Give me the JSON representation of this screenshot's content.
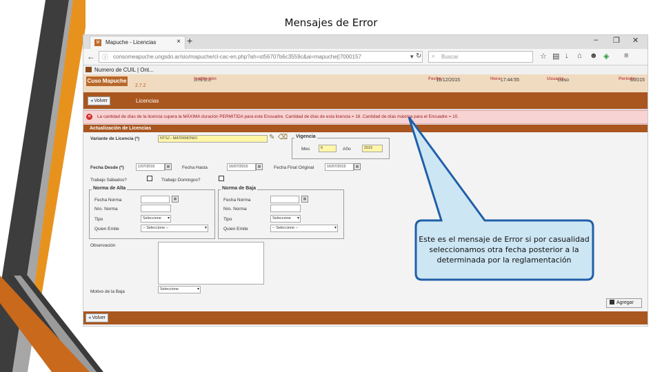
{
  "slide": {
    "title": "Mensajes de Error"
  },
  "browser": {
    "tab_title": "Mapuche - Licencias",
    "tab_favicon": "mapuche-favicon",
    "new_tab": "+",
    "minimize": "–",
    "restore": "❐",
    "close": "✕",
    "url": "consomeapuche.ungsdo.ar/sio/mapuche/cl-cac-en.php?ah=st56707b6c3559c&ai=mapuche||7000157",
    "search_placeholder": "Buscar",
    "bookmark": "Numero de CUIL | Ont..."
  },
  "app": {
    "logo": "Cuso Mapuche",
    "version": "2.7.2",
    "header_cols": [
      {
        "label": "Institución",
        "value": "U.N.S.J."
      },
      {
        "label": "Fecha",
        "value": "11/12/2015"
      },
      {
        "label": "Hora",
        "value": "17:44:55"
      },
      {
        "label": "Usuario",
        "value": "cuiso"
      },
      {
        "label": "Período",
        "value": "6/2015"
      }
    ],
    "back_button": "Volver",
    "section_title": "Licencias",
    "error_message": "La cantidad de días de la licencia supera la MÁXIMA duración PERMITIDA para este Encuadre. Cantidad de días de esta licencia = 16. Cantidad de días máxima para el Encuadre = 10.",
    "form_header": "Actualización de Licencias"
  },
  "form": {
    "variante_label": "Variante de Licencia (*)",
    "variante_value": "NTSJ - MATRIMONIO",
    "vigencia_legend": "Vigencia",
    "mes_label": "Mes",
    "mes_value": "6",
    "anio_label": "Año",
    "anio_value": "2015",
    "fecha_desde_label": "Fecha Desde (*)",
    "fecha_desde_value": "1/07/2015",
    "fecha_hasta_label": "Fecha Hasta",
    "fecha_hasta_value": "16/07/2015",
    "fecha_final_label": "Fecha Final Original",
    "fecha_final_value": "16/07/2015",
    "trabajo_sabados_label": "Trabajo Sábados?",
    "trabajo_domingos_label": "Trabajo Domingos?",
    "alta_legend": "Norma de Alta",
    "baja_legend": "Norma de Baja",
    "fecha_norma_label": "Fecha Norma",
    "nro_norma_label": "Nro. Norma",
    "tipo_label": "Tipo",
    "tipo_value": "Seleccione",
    "quien_emite_label": "Quien Emite",
    "quien_emite_value": "-- Seleccione --",
    "observacion_label": "Observación",
    "motivo_label": "Motivo de la Baja",
    "motivo_value": "Seleccione",
    "agregar_button": "Agregar",
    "back_button": "Volver"
  },
  "callout": {
    "text": "Este es el mensaje de Error si por casualidad seleccionamos otra fecha posterior a la determinada por la reglamentación",
    "fill": "#cde6f4",
    "stroke": "#1f5fa8"
  },
  "colors": {
    "accent_orange": "#e8921e",
    "dark_stripe": "#3a3a3a",
    "app_brown": "#a9561f",
    "error_bg": "#f7d3d3"
  }
}
